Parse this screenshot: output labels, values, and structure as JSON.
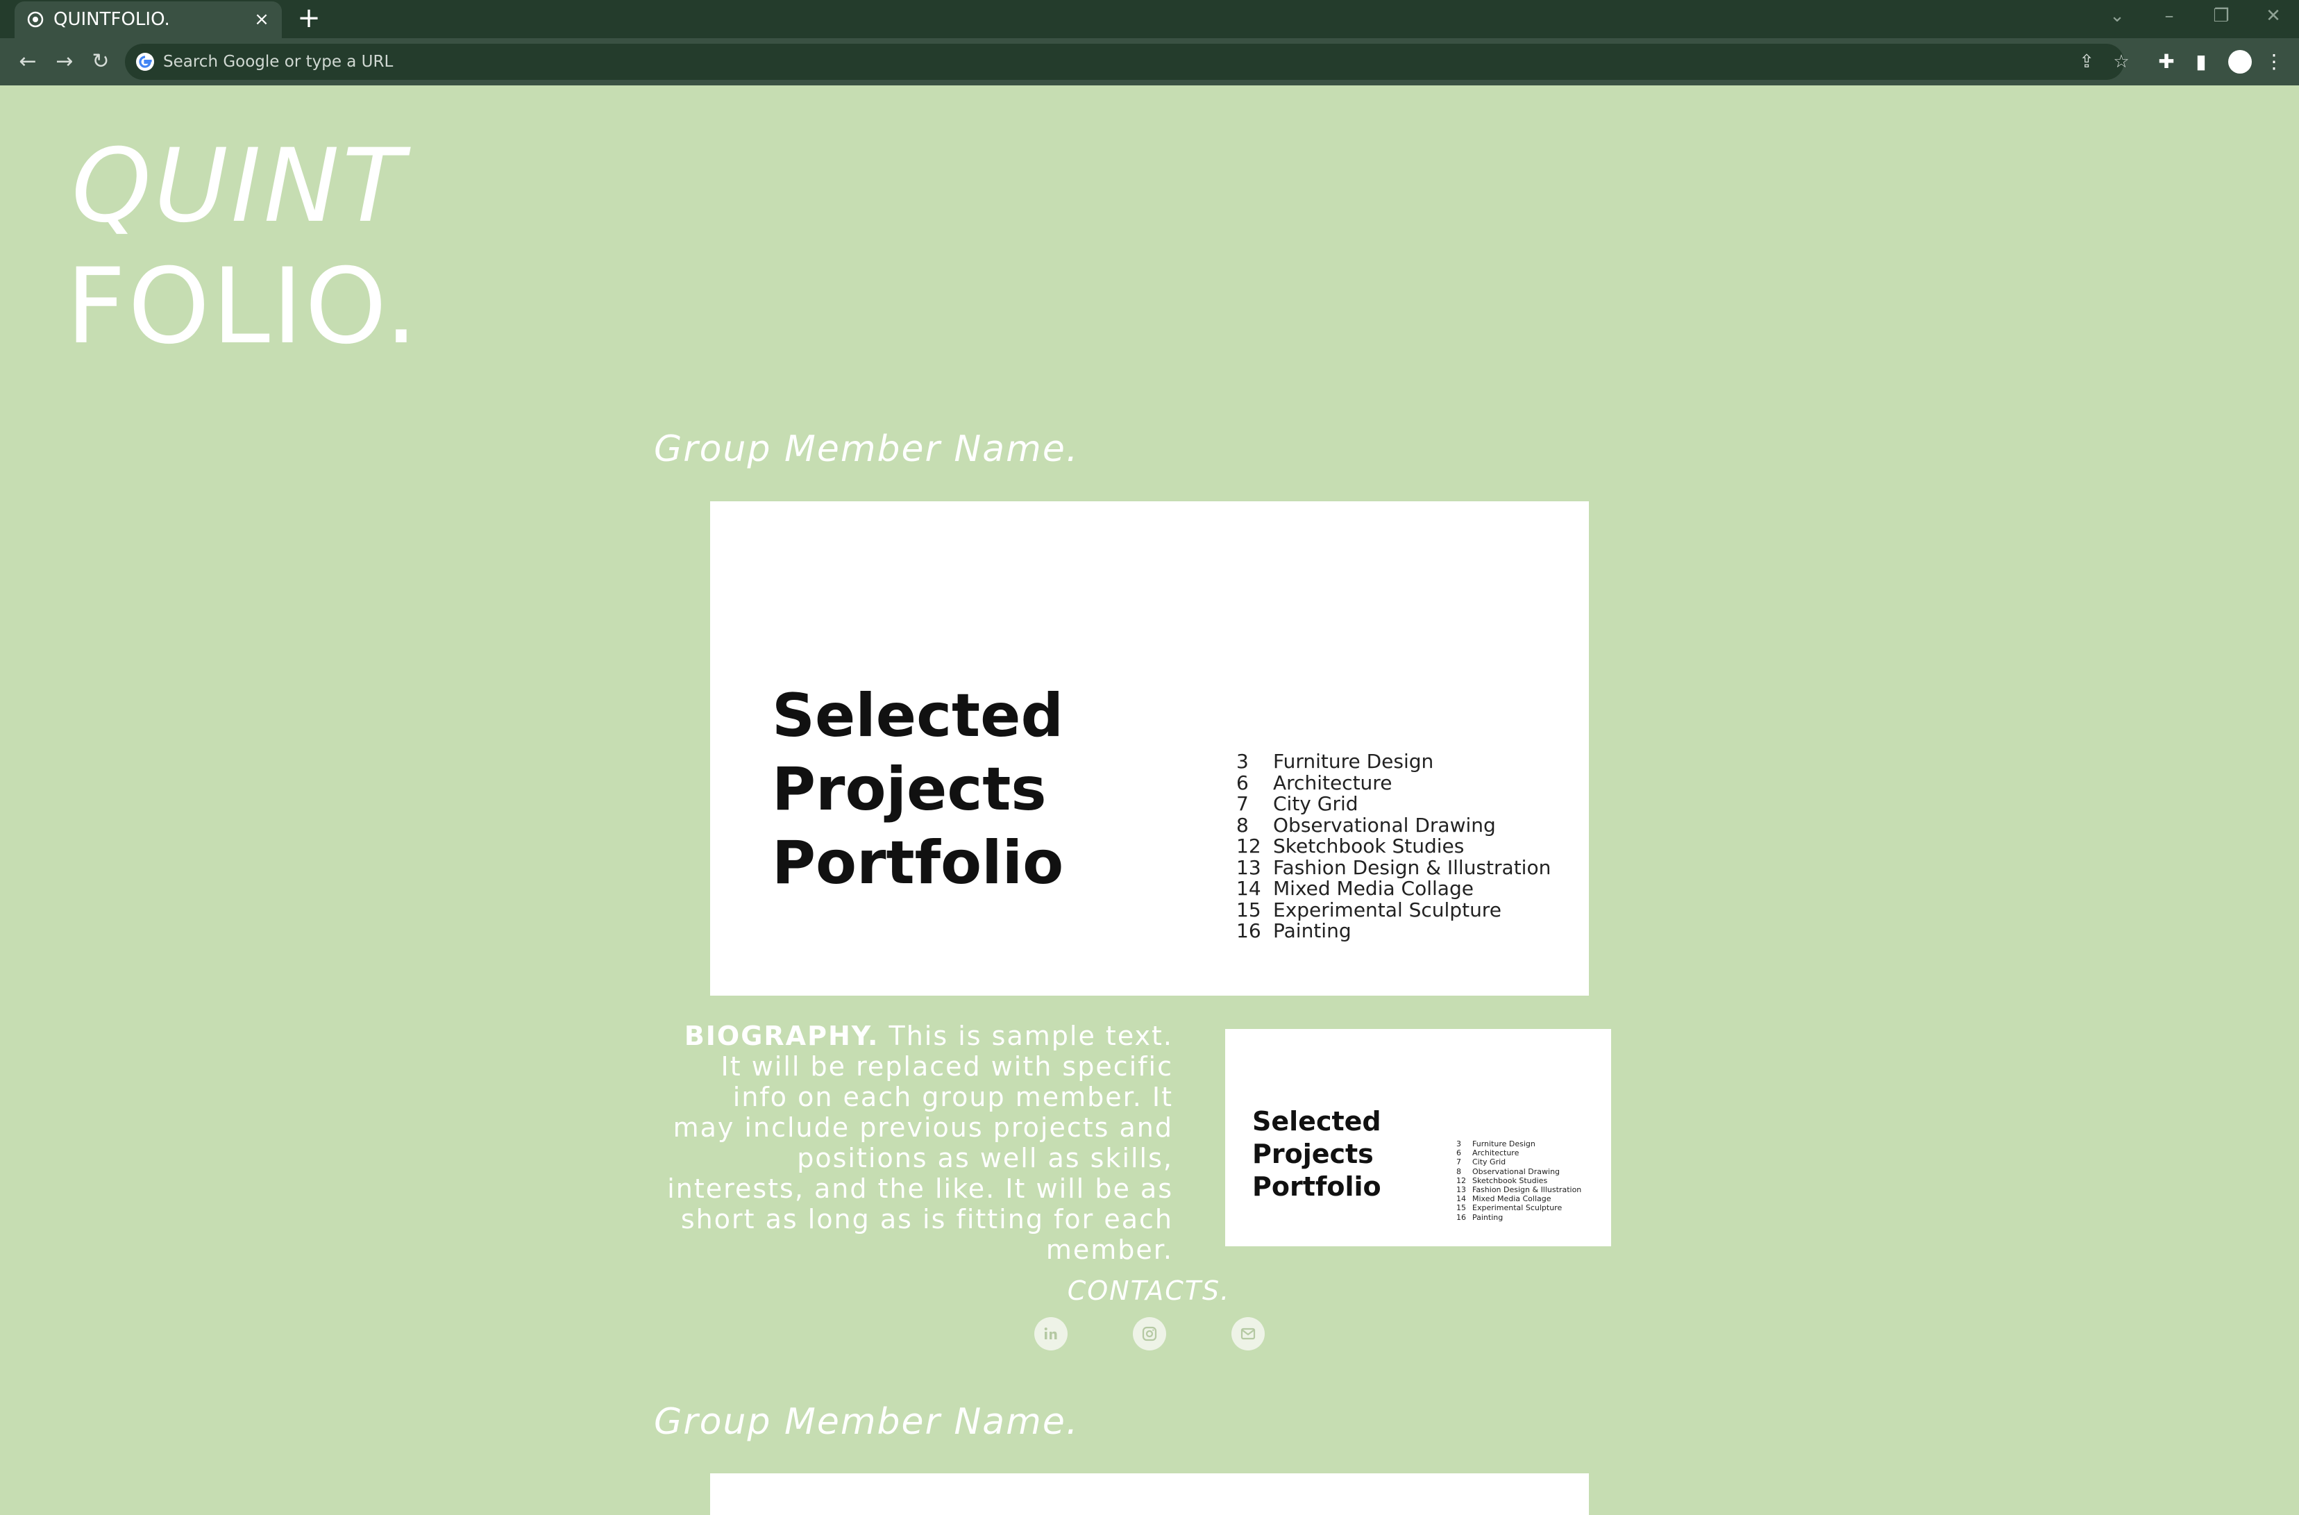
{
  "browser": {
    "tab_title": "QUINTFOLIO.",
    "tab_close": "×",
    "new_tab": "+",
    "omnibox_placeholder": "Search Google or type a URL"
  },
  "page": {
    "logo_line1": "QUINT",
    "logo_line2": "FOLIO.",
    "members": [
      {
        "name": "Group Member Name.",
        "portfolio": {
          "title_lines": [
            "Selected",
            "Projects",
            "Portfolio"
          ],
          "contents": [
            {
              "page": "3",
              "title": "Furniture Design"
            },
            {
              "page": "6",
              "title": "Architecture"
            },
            {
              "page": "7",
              "title": "City Grid"
            },
            {
              "page": "8",
              "title": "Observational Drawing"
            },
            {
              "page": "12",
              "title": "Sketchbook Studies"
            },
            {
              "page": "13",
              "title": "Fashion Design & Illustration"
            },
            {
              "page": "14",
              "title": "Mixed Media Collage"
            },
            {
              "page": "15",
              "title": "Experimental Sculpture"
            },
            {
              "page": "16",
              "title": "Painting"
            }
          ]
        },
        "bio_heading": "BIOGRAPHY.",
        "bio_text": "This is sample text. It will be replaced with specific info on each group member. It may include previous projects and positions as well as skills, interests, and the like. It will be as short as long as is fitting for each member.",
        "contacts_label": "CONTACTS.",
        "contact_icons": [
          "linkedin-icon",
          "instagram-icon",
          "mail-icon"
        ]
      },
      {
        "name": "Group Member Name."
      }
    ]
  }
}
